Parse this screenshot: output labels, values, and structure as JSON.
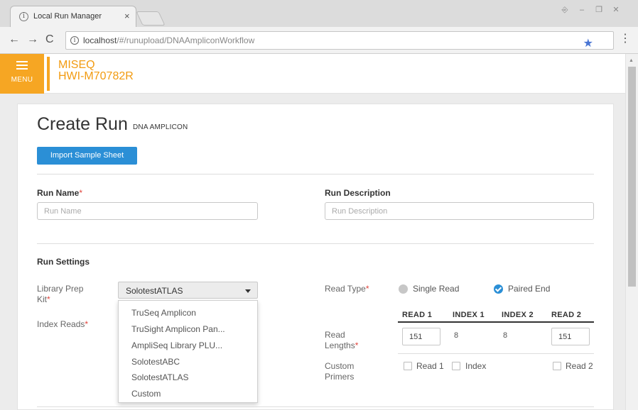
{
  "browser": {
    "tab_title": "Local Run Manager",
    "tab_close": "×",
    "url_host": "localhost",
    "url_path": "/#/runupload/DNAAmpliconWorkflow",
    "window_controls": [
      "⎆",
      "–",
      "❐",
      "✕"
    ]
  },
  "header": {
    "menu_label": "MENU",
    "instrument_line1": "MISEQ",
    "instrument_line2": "HWI-M70782R",
    "accent_color": "#f6a623"
  },
  "page": {
    "title": "Create Run",
    "subtitle": "DNA AMPLICON",
    "import_button": "Import Sample Sheet",
    "run_name_label": "Run Name",
    "run_name_placeholder": "Run Name",
    "run_description_label": "Run Description",
    "run_description_placeholder": "Run Description",
    "required_marker": "*",
    "run_settings_heading": "Run Settings"
  },
  "library_prep": {
    "label_line1": "Library Prep",
    "label_line2": "Kit",
    "selected": "SolotestATLAS",
    "options": [
      "TruSeq Amplicon",
      "TruSight Amplicon Pan...",
      "AmpliSeq Library PLU...",
      "SolotestABC",
      "SolotestATLAS",
      "Custom"
    ]
  },
  "index_reads": {
    "label": "Index Reads"
  },
  "read_type": {
    "label": "Read Type",
    "single_read": "Single Read",
    "paired_end": "Paired End",
    "selected": "Paired End"
  },
  "reads_table": {
    "columns": [
      "READ 1",
      "INDEX 1",
      "INDEX 2",
      "READ 2"
    ],
    "read_lengths_label_line1": "Read",
    "read_lengths_label_line2": "Lengths",
    "read1": "151",
    "index1": "8",
    "index2": "8",
    "read2": "151",
    "custom_primers_line1": "Custom",
    "custom_primers_line2": "Primers",
    "primer_read1": "Read 1",
    "primer_index": "Index",
    "primer_read2": "Read 2"
  },
  "colors": {
    "primary_blue": "#2b8fd6",
    "required_red": "#e0443c"
  }
}
